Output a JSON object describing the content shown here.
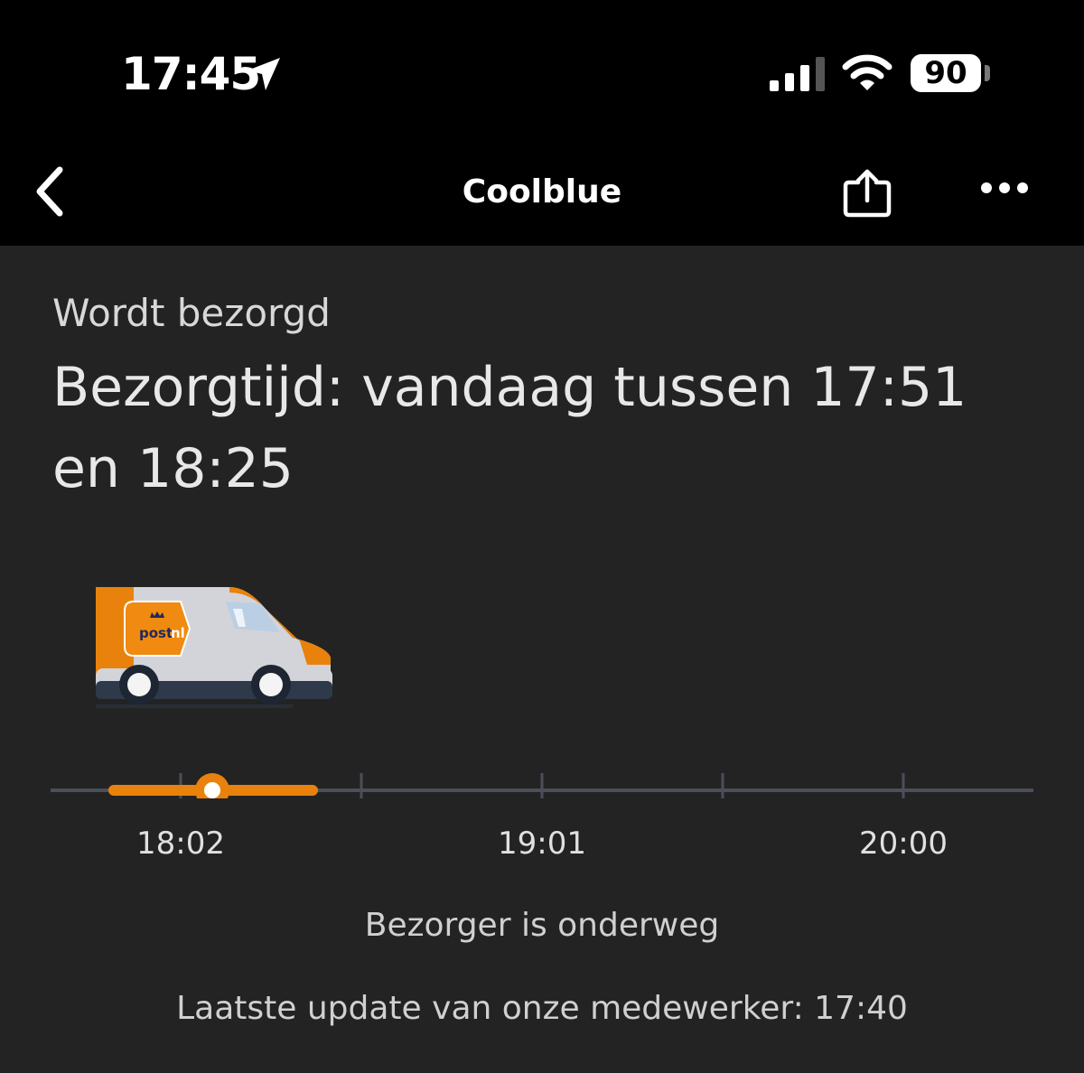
{
  "status_bar": {
    "time": "17:45",
    "battery": "90",
    "icons": [
      "location-arrow-icon",
      "cellular-signal-icon",
      "wifi-icon",
      "battery-icon"
    ]
  },
  "nav": {
    "title": "Coolblue",
    "icons": [
      "chevron-left-icon",
      "share-icon",
      "more-icon"
    ]
  },
  "delivery": {
    "status": "Wordt bezorgd",
    "time_text": "Bezorgtijd: vandaag tussen 17:51 en 18:25",
    "van_logo_text": "postnl"
  },
  "timeline": {
    "tick_labels": [
      "18:02",
      "19:01",
      "20:00"
    ],
    "window_start": "17:51",
    "window_end": "18:25",
    "current_position": "18:10"
  },
  "courier_status": "Bezorger is onderweg",
  "last_update": "Laatste update van onze medewerker: 17:40",
  "colors": {
    "background": "#232323",
    "bars": "#000000",
    "accent": "#E8820C",
    "text": "#E6E6E6"
  }
}
